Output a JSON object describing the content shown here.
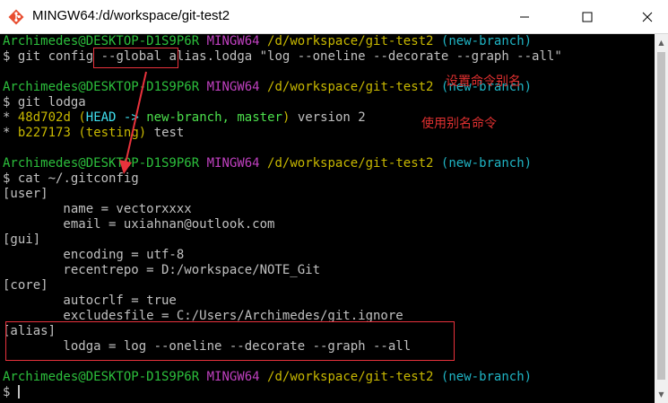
{
  "window": {
    "title": "MINGW64:/d/workspace/git-test2",
    "minimize_glyph": "—",
    "maximize_glyph": "☐",
    "close_glyph": "✕"
  },
  "prompt": {
    "user": "Archimedes@DESKTOP-D1S9P6R",
    "env": "MINGW64",
    "path": "/d/workspace/git-test2",
    "branch": "(new-branch)",
    "symbol": "$"
  },
  "commands": {
    "cmd1_pre": "git config ",
    "cmd1_flag": "--global",
    "cmd1_post": " alias.lodga \"log --oneline --decorate --graph --all\"",
    "cmd2": "git lodga",
    "cmd3": "cat ~/.gitconfig"
  },
  "log": [
    {
      "graph": "*",
      "hash": "48d702d",
      "open": "(",
      "head": "HEAD ->",
      "branch": " new-branch,",
      "master": " master",
      "close": ")",
      "msg": " version 2"
    },
    {
      "graph": "*",
      "hash": "b227173",
      "open": "(",
      "tag": "testing",
      "close": ")",
      "msg": " test"
    }
  ],
  "gitconfig": [
    "[user]",
    "        name = vectorxxxx",
    "        email = uxiahnan@outlook.com",
    "[gui]",
    "        encoding = utf-8",
    "        recentrepo = D:/workspace/NOTE_Git",
    "[core]",
    "        autocrlf = true",
    "        excludesfile = C:/Users/Archimedes/git.ignore",
    "[alias]",
    "        lodga = log --oneline --decorate --graph --all"
  ],
  "annotations": {
    "note1": "设置命令别名",
    "note2": "使用别名命令",
    "color": "#e03030"
  },
  "colors": {
    "background": "#000000",
    "prompt_user": "#2cbf3c",
    "prompt_env": "#bf40bf",
    "prompt_path": "#c8b800",
    "prompt_branch": "#1fb4c4",
    "text": "#c0c0c0"
  },
  "scrollbar": {
    "up_glyph": "▲",
    "down_glyph": "▼"
  }
}
